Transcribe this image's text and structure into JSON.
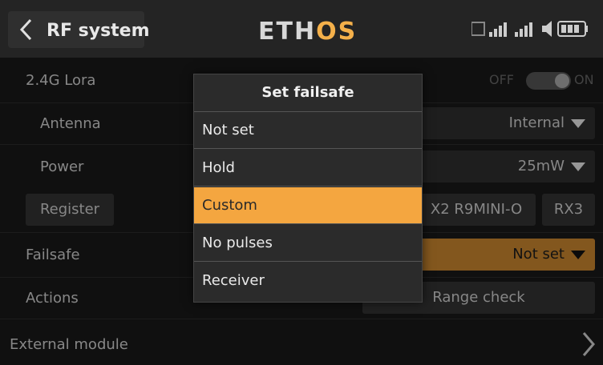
{
  "header": {
    "title": "RF system",
    "logo_prefix": "ETH",
    "logo_accent": "OS",
    "accent_color": "#f4a640"
  },
  "rows": {
    "lora_label": "2.4G Lora",
    "toggle_off": "OFF",
    "toggle_on": "ON",
    "antenna_label": "Antenna",
    "antenna_value": "Internal",
    "power_label": "Power",
    "power_value": "25mW",
    "register_label": "Register",
    "receiver_name": "X2 R9MINI-O",
    "rx3_label": "RX3",
    "failsafe_label": "Failsafe",
    "failsafe_value": "Not set",
    "actions_label": "Actions",
    "range_check_label": "Range check",
    "external_label": "External module"
  },
  "dialog": {
    "title": "Set failsafe",
    "items": [
      "Not set",
      "Hold",
      "Custom",
      "No pulses",
      "Receiver"
    ],
    "selected": "Custom"
  }
}
